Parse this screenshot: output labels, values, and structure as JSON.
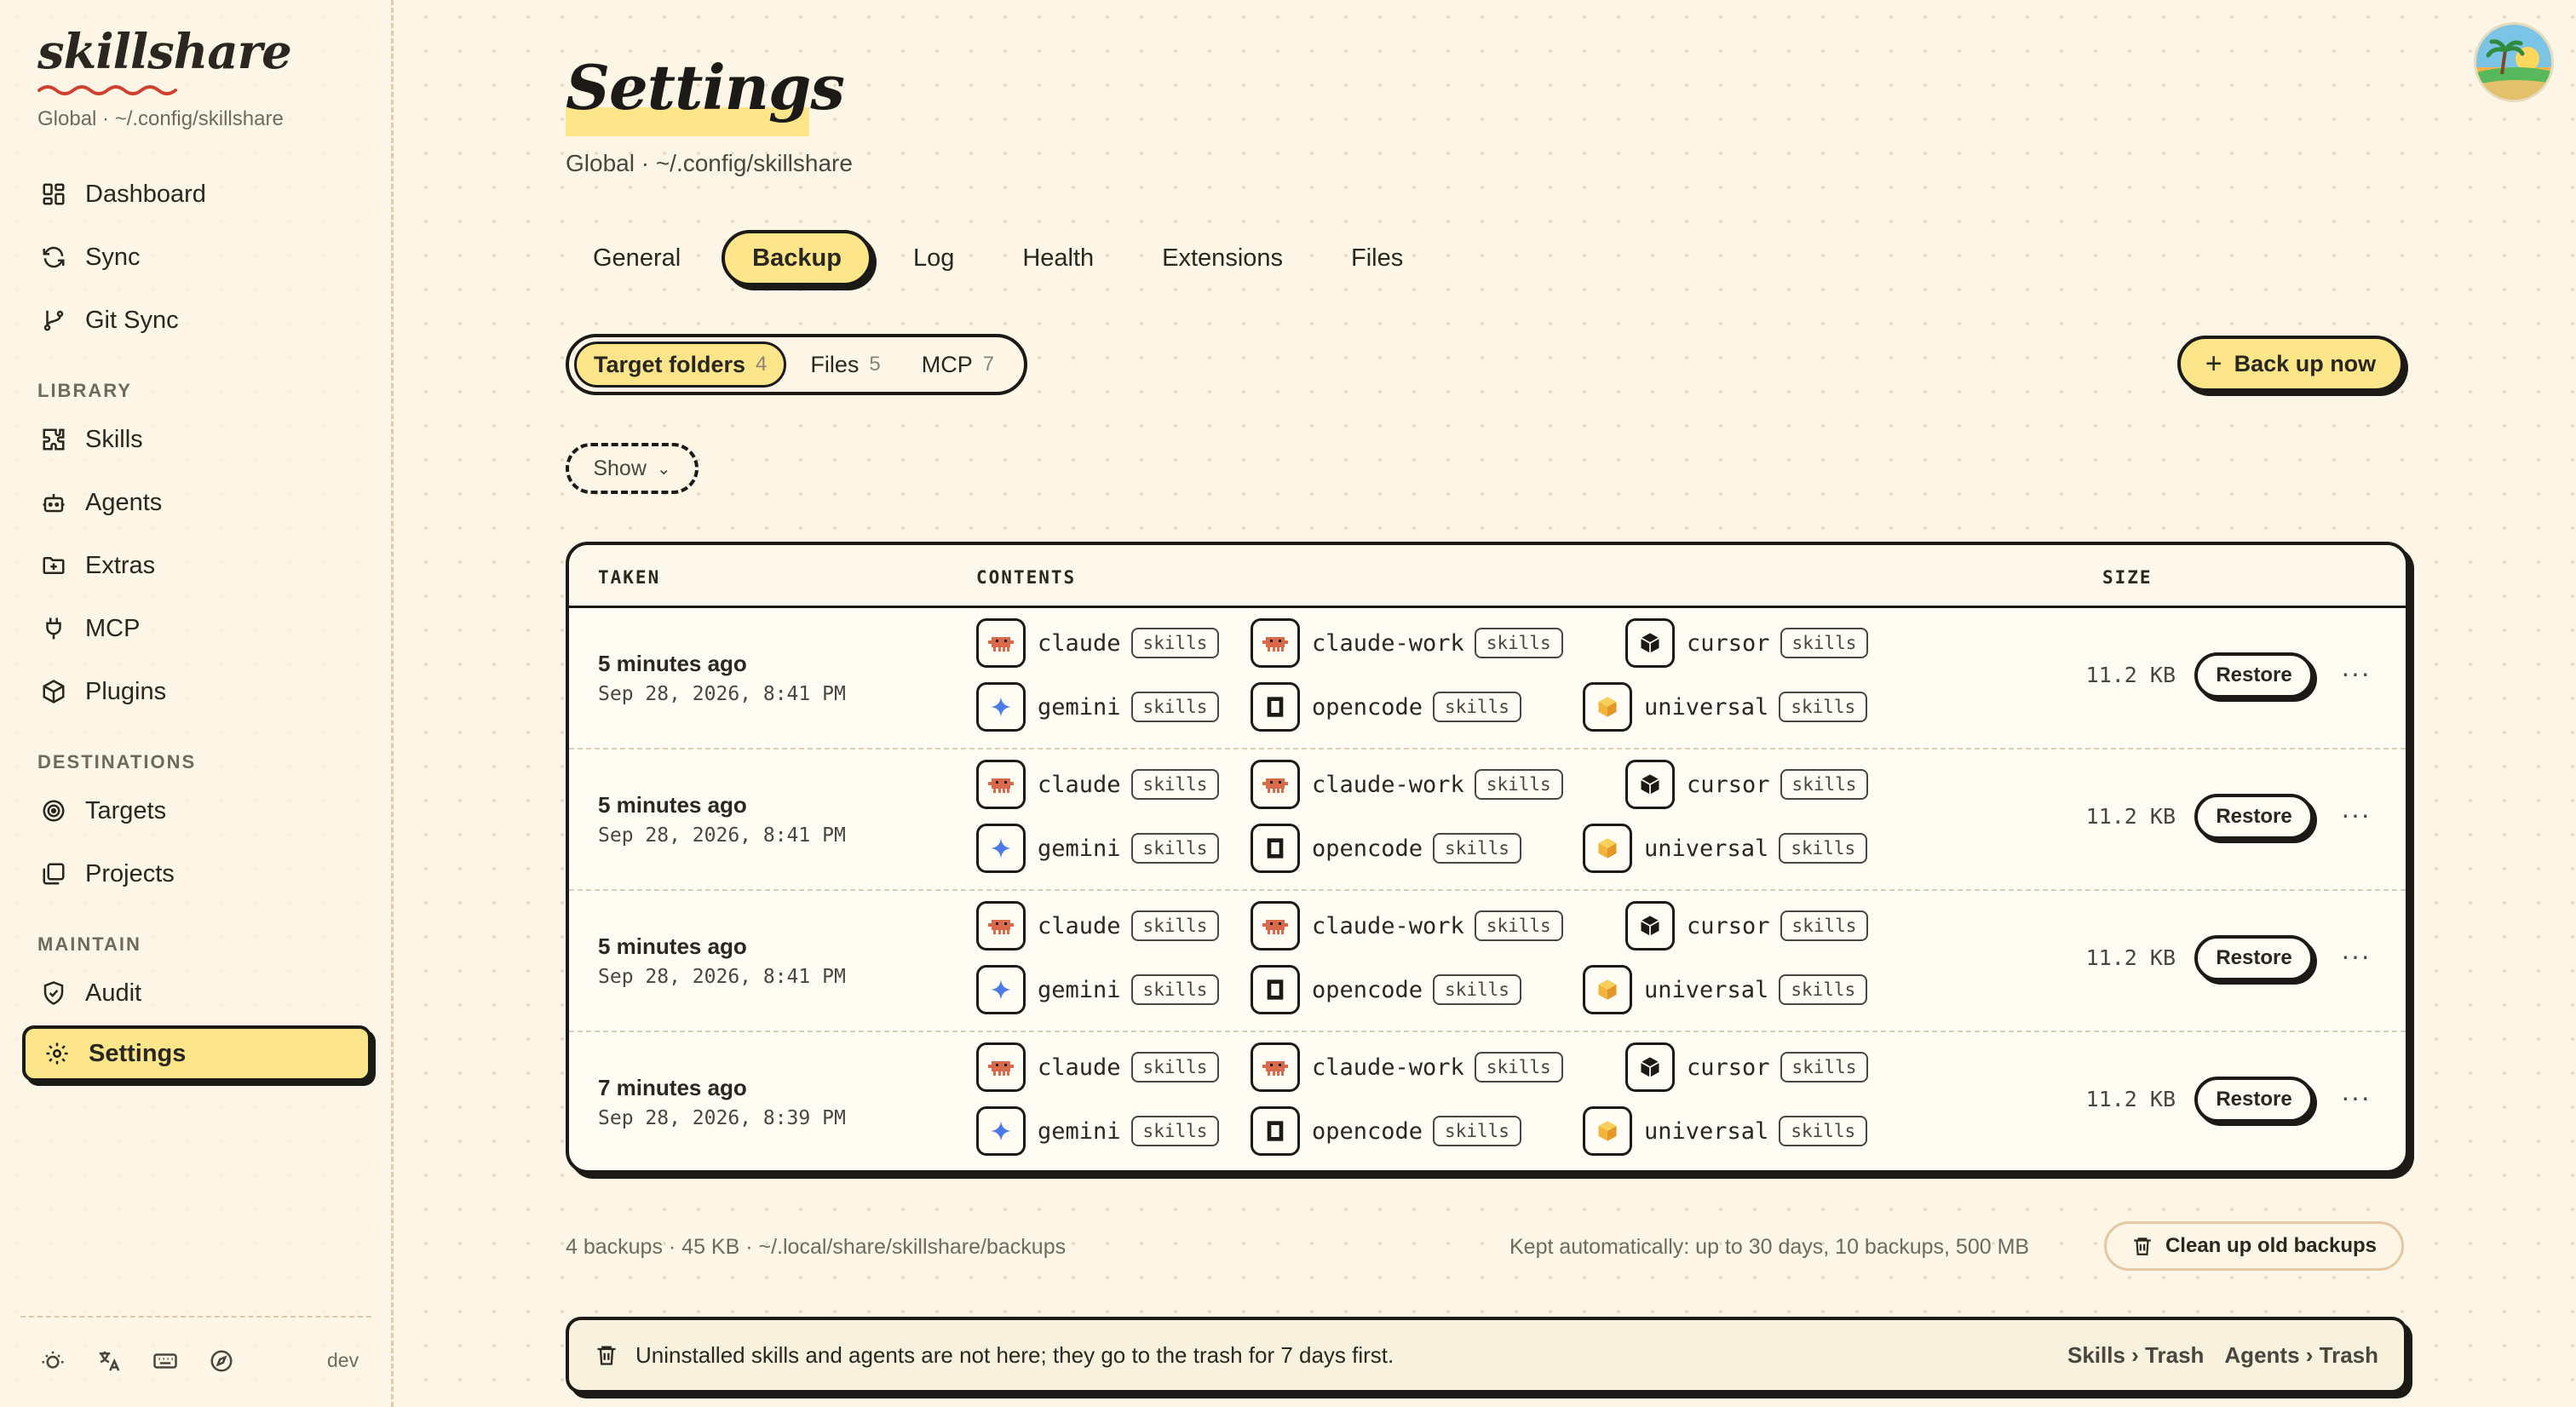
{
  "app": {
    "logo": "skillshare",
    "scope": "Global · ~/.config/skillshare"
  },
  "sidebar": {
    "items_top": [
      {
        "label": "Dashboard",
        "icon": "dashboard-icon"
      },
      {
        "label": "Sync",
        "icon": "sync-icon"
      },
      {
        "label": "Git Sync",
        "icon": "git-branch-icon"
      }
    ],
    "sections": {
      "library": "LIBRARY",
      "destinations": "DESTINATIONS",
      "maintain": "MAINTAIN"
    },
    "library_items": [
      {
        "label": "Skills",
        "icon": "puzzle-icon"
      },
      {
        "label": "Agents",
        "icon": "robot-icon"
      },
      {
        "label": "Extras",
        "icon": "folder-plus-icon"
      },
      {
        "label": "MCP",
        "icon": "plug-icon"
      },
      {
        "label": "Plugins",
        "icon": "package-icon"
      }
    ],
    "destination_items": [
      {
        "label": "Targets",
        "icon": "target-icon"
      },
      {
        "label": "Projects",
        "icon": "projects-icon"
      }
    ],
    "maintain_items": [
      {
        "label": "Audit",
        "icon": "shield-check-icon"
      },
      {
        "label": "Settings",
        "icon": "gear-icon"
      }
    ],
    "footer_label": "dev"
  },
  "page": {
    "title": "Settings",
    "subtitle": "Global · ~/.config/skillshare"
  },
  "tabs": [
    "General",
    "Backup",
    "Log",
    "Health",
    "Extensions",
    "Files"
  ],
  "active_tab": "Backup",
  "segments": [
    {
      "label": "Target folders",
      "count": "4"
    },
    {
      "label": "Files",
      "count": "5"
    },
    {
      "label": "MCP",
      "count": "7"
    }
  ],
  "backup_button": "Back up now",
  "show_button": "Show",
  "table": {
    "headers": {
      "taken": "TAKEN",
      "contents": "CONTENTS",
      "size": "SIZE"
    },
    "restore_label": "Restore",
    "more_label": "···",
    "tag": "skills",
    "contents": [
      "claude",
      "claude-work",
      "cursor",
      "gemini",
      "opencode",
      "universal"
    ],
    "rows": [
      {
        "relative": "5 minutes ago",
        "absolute": "Sep 28, 2026, 8:41 PM",
        "size": "11.2 KB"
      },
      {
        "relative": "5 minutes ago",
        "absolute": "Sep 28, 2026, 8:41 PM",
        "size": "11.2 KB"
      },
      {
        "relative": "5 minutes ago",
        "absolute": "Sep 28, 2026, 8:41 PM",
        "size": "11.2 KB"
      },
      {
        "relative": "7 minutes ago",
        "absolute": "Sep 28, 2026, 8:39 PM",
        "size": "11.2 KB"
      }
    ]
  },
  "footer": {
    "stats": "4 backups · 45 KB · ~/.local/share/skillshare/backups",
    "kept": "Kept automatically: up to 30 days, 10 backups, 500 MB",
    "cleanup": "Clean up old backups"
  },
  "notice": {
    "text": "Uninstalled skills and agents are not here; they go to the trash for 7 days first.",
    "link1": "Skills › Trash",
    "link2": "Agents › Trash"
  },
  "colors": {
    "accent": "#fde58a",
    "ink": "#1c1a17",
    "background": "#fdf6e6",
    "claude": "#d9694a",
    "gemini": "#4b7be8",
    "universal": "#f2b43a"
  }
}
